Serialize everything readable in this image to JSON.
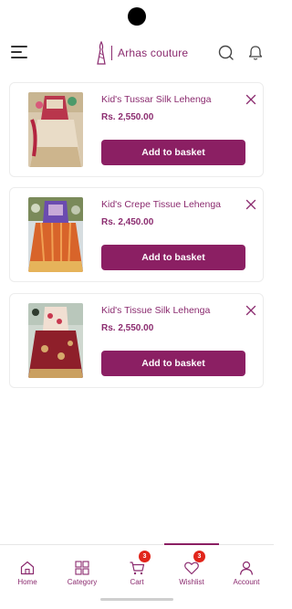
{
  "header": {
    "brand_name": "Arhas couture",
    "accent_color": "#8b1f63"
  },
  "wishlist": {
    "items": [
      {
        "title": "Kid's Tussar Silk Lehenga",
        "price": "Rs. 2,550.00",
        "button_label": "Add to basket",
        "image_icon": "lehenga-cream-red-image"
      },
      {
        "title": "Kid's Crepe Tissue Lehenga",
        "price": "Rs. 2,450.00",
        "button_label": "Add to basket",
        "image_icon": "lehenga-orange-image"
      },
      {
        "title": "Kid's Tissue Silk Lehenga",
        "price": "Rs. 2,550.00",
        "button_label": "Add to basket",
        "image_icon": "lehenga-maroon-image"
      }
    ]
  },
  "bottom_nav": {
    "items": [
      {
        "label": "Home",
        "icon": "home-icon"
      },
      {
        "label": "Category",
        "icon": "grid-icon"
      },
      {
        "label": "Cart",
        "icon": "cart-icon",
        "badge": "3"
      },
      {
        "label": "Wishlist",
        "icon": "heart-icon",
        "badge": "3",
        "active": true
      },
      {
        "label": "Account",
        "icon": "user-icon"
      }
    ]
  }
}
